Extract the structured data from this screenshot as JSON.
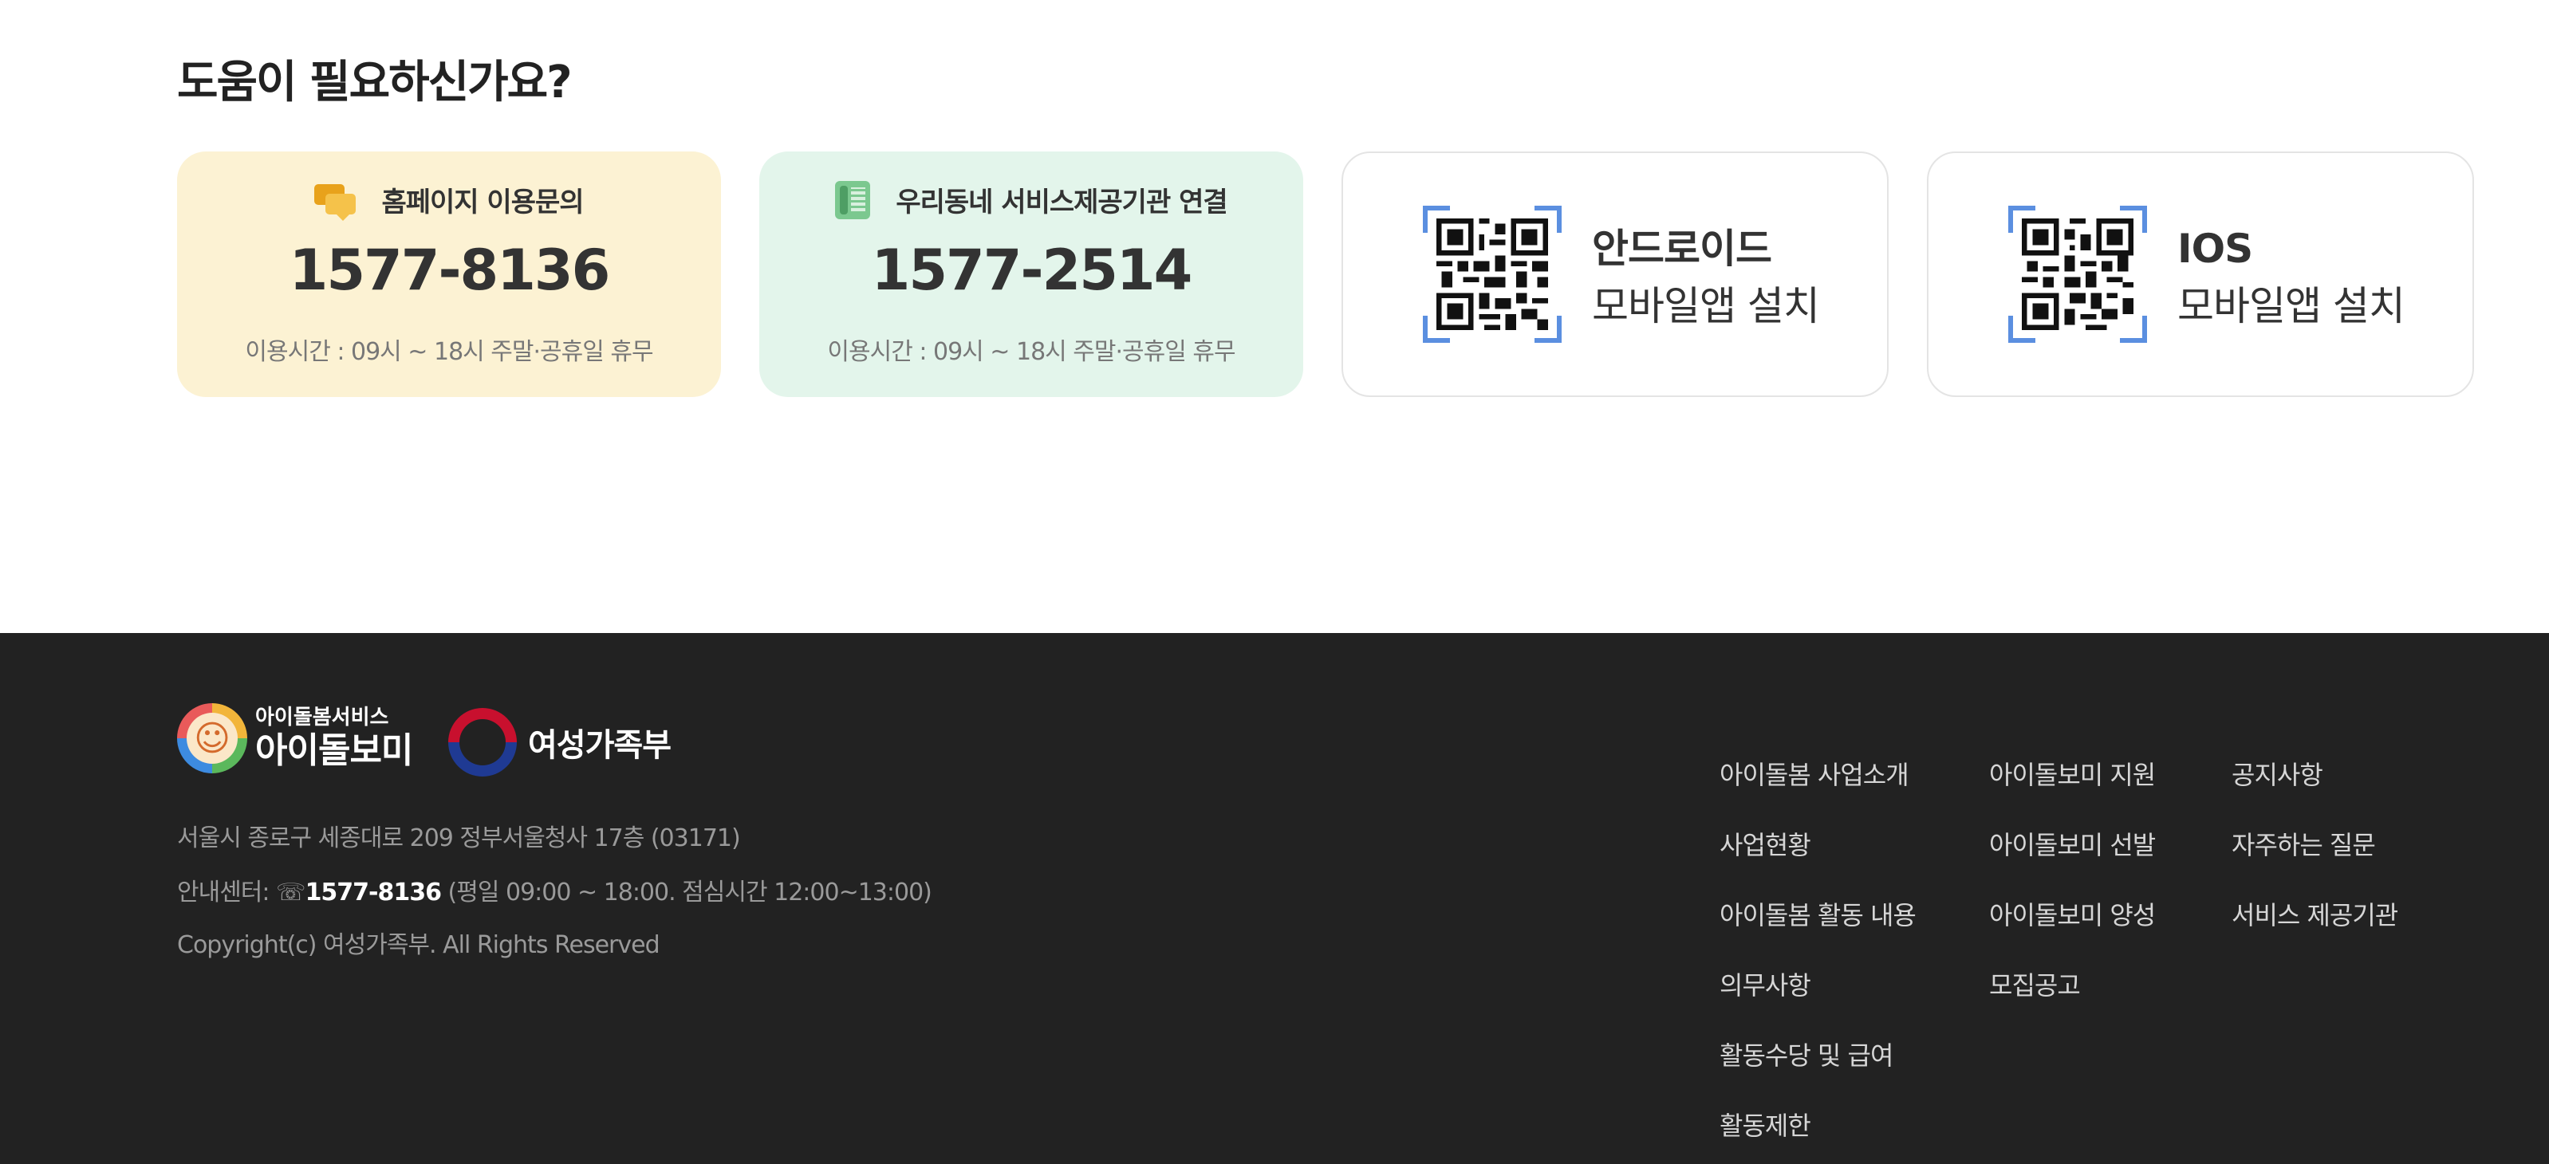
{
  "help": {
    "title": "도움이 필요하신가요?",
    "cards": [
      {
        "label": "홈페이지 이용문의",
        "phone": "1577-8136",
        "hours": "이용시간 : 09시 ~ 18시 주말·공휴일 휴무",
        "icon": "chat-bubble-icon",
        "bg": "#fcf2d3"
      },
      {
        "label": "우리동네 서비스제공기관 연결",
        "phone": "1577-2514",
        "hours": "이용시간 : 09시 ~ 18시 주말·공휴일 휴무",
        "icon": "telephone-icon",
        "bg": "#e3f5eb"
      }
    ],
    "apps": [
      {
        "line1": "안드로이드",
        "line2": "모바일앱 설치",
        "icon": "qr-code-icon"
      },
      {
        "line1": "IOS",
        "line2": "모바일앱 설치",
        "icon": "qr-code-icon"
      }
    ]
  },
  "footer": {
    "logo_idol_sub": "아이돌봄서비스",
    "logo_idol_main": "아이돌보미",
    "logo_gov": "여성가족부",
    "address": "서울시 종로구 세종대로 209 정부서울청사 17층 (03171)",
    "center_label": "안내센터: ☏",
    "center_tel": "1577-8136",
    "center_hours": " (평일 09:00 ~ 18:00. 점심시간 12:00~13:00)",
    "copyright": "Copyright(c) 여성가족부. All Rights Reserved",
    "menu_col1": [
      "아이돌봄 사업소개",
      "사업현황",
      "아이돌봄 활동 내용",
      "의무사항",
      "활동수당 및 급여",
      "활동제한"
    ],
    "menu_col2": [
      "아이돌보미 지원",
      "아이돌보미 선발",
      "아이돌보미 양성",
      "모집공고"
    ],
    "menu_col3": [
      "공지사항",
      "자주하는 질문",
      "서비스 제공기관"
    ],
    "bg": "#222222"
  }
}
